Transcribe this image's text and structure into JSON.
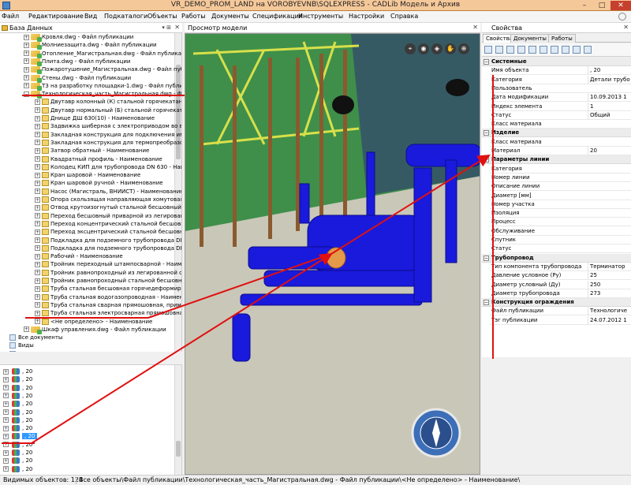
{
  "window": {
    "title": "VR_DEMO_PROM_LAND на VOROBYEVNB\\SQLEXPRESS - CADLib Модель и Архив",
    "min": "–",
    "max": "□",
    "close": "✕"
  },
  "menu": [
    "Файл",
    "Редактирование",
    "Вид",
    "Подкаталоги",
    "Объекты",
    "Работы",
    "Документы",
    "Спецификация",
    "Инструменты",
    "Настройки",
    "Справка"
  ],
  "left_panel": {
    "title": "База Данных",
    "pin": "▾ ⊞",
    "close": "✕"
  },
  "tree": [
    {
      "text": "Кровля.dwg - Файл публикации"
    },
    {
      "text": "Молниезащита.dwg - Файл публикации"
    },
    {
      "text": "Отопление_Магистральная.dwg - Файл публикации"
    },
    {
      "text": "Плита.dwg - Файл публикации"
    },
    {
      "text": "Пожаротушение_Магистральная.dwg - Файл публикации"
    },
    {
      "text": "Стены.dwg - Файл публикации"
    },
    {
      "text": "ТЗ на разработку площадки-1.dwg - Файл публикации"
    },
    {
      "text": "Технологическая_часть_Магистральная.dwg - Файл публ"
    }
  ],
  "children": [
    "Двутавр колонный (К) стальной горячекатанный с п",
    "Двутавр нормальный (Б) стальной горячекатанный",
    "Днище ДШ 630(10) - Наименование",
    "Задвижка шиберная с электроприводом во взрывоз",
    "Закладная конструкция для подключения импульсн",
    "Закладная конструкция для термопреобразователя",
    "Затвор обратный - Наименование",
    "Квадратный профиль - Наименование",
    "Колодец КИП для трубопровода DN 630 - Наименова",
    "Кран шаровой - Наименование",
    "Кран шаровой ручной - Наименование",
    "Насос (Магистраль, ВНИИСТ) - Наименование",
    "Опора скользящая направляющая хомутовая DN 35",
    "Отвод крутоизогнутый стальной бесшовный привар",
    "Переход бесшовный приварной из легированной ст",
    "Переход концентрический стальной бесшовный при",
    "Переход эксцентрический стальной бесшовный при",
    "Подкладка для подземного трубопровода DN 350 -",
    "Подкладка для подземного трубопровода DN 600 -",
    "Рабочий - Наименование",
    "Тройник переходный штампосварной - Наименован",
    "Тройник равнопроходный из легированной стали -",
    "Тройник равнопроходный стальной бесшовный прив",
    "Труба стальная бесшовная горячедеформированна",
    "Труба стальная водогазопроводная - Наименовани",
    "Труба стальная сварная прямошовная, применяем",
    "Труба стальная электросварная прямошовная - На",
    "<Не определено> - Наименование"
  ],
  "after_tree": [
    {
      "text": "Шкаф управления.dwg - Файл публикации"
    }
  ],
  "extra_nodes": [
    "Все документы",
    "Виды",
    "Заметки"
  ],
  "bottom_list": {
    "value": ", 20",
    "count": 13,
    "selected_index": 8
  },
  "viewport": {
    "title": "Просмотр модели",
    "close": "✕",
    "tools": [
      "⌖",
      "◉",
      "◈",
      "✋",
      "⊕"
    ]
  },
  "properties_panel": {
    "title": "Свойства",
    "close": "✕",
    "tabs": [
      "Свойства",
      "Документы",
      "Работы"
    ],
    "categories": [
      {
        "name": "Системные",
        "rows": [
          [
            "Имя объекта",
            ", 20"
          ],
          [
            "Категория",
            "Детали трубо"
          ],
          [
            "Пользователь",
            ""
          ],
          [
            "Дата модификации",
            "10.09.2013 1"
          ],
          [
            "Индекс элемента",
            "1"
          ],
          [
            "Статус",
            "Общий"
          ],
          [
            "Класс материала",
            ""
          ]
        ]
      },
      {
        "name": "Изделие",
        "rows": [
          [
            "Класс материала",
            ""
          ],
          [
            "Материал",
            "20"
          ]
        ]
      },
      {
        "name": "Параметры линии",
        "rows": [
          [
            "Категория",
            ""
          ],
          [
            "Номер линии",
            ""
          ],
          [
            "Описание линии",
            ""
          ],
          [
            "Диаметр [мм]",
            ""
          ],
          [
            "Номер участка",
            ""
          ],
          [
            "Изоляция",
            ""
          ],
          [
            "Процесс",
            ""
          ],
          [
            "Обслуживание",
            ""
          ],
          [
            "Спутник",
            ""
          ],
          [
            "Статус",
            ""
          ]
        ]
      },
      {
        "name": "Трубопровод",
        "rows": [
          [
            "Тип компонента трубопровода",
            "Терминатор"
          ],
          [
            "Давление условное (Ру)",
            "25"
          ],
          [
            "Диаметр условный (Ду)",
            "250"
          ],
          [
            "Диаметр трубопровода",
            "273"
          ]
        ]
      },
      {
        "name": "Конструкция ограждения",
        "rows": [
          [
            "Файл публикации",
            "Технологиче"
          ],
          [
            "Тэг публикации",
            "24.07.2012 1"
          ]
        ]
      }
    ]
  },
  "status": {
    "visible_label": "Видимых объектов: 124",
    "path": "Все объекты\\Файл публикации\\Технологическая_часть_Магистральная.dwg - Файл публикации\\<Не определено> - Наименование\\"
  },
  "colors": {
    "annotation": "#e01010",
    "pipe": "#1a1adc",
    "selection": "#3399ff",
    "titlebar": "#f5c89a"
  }
}
